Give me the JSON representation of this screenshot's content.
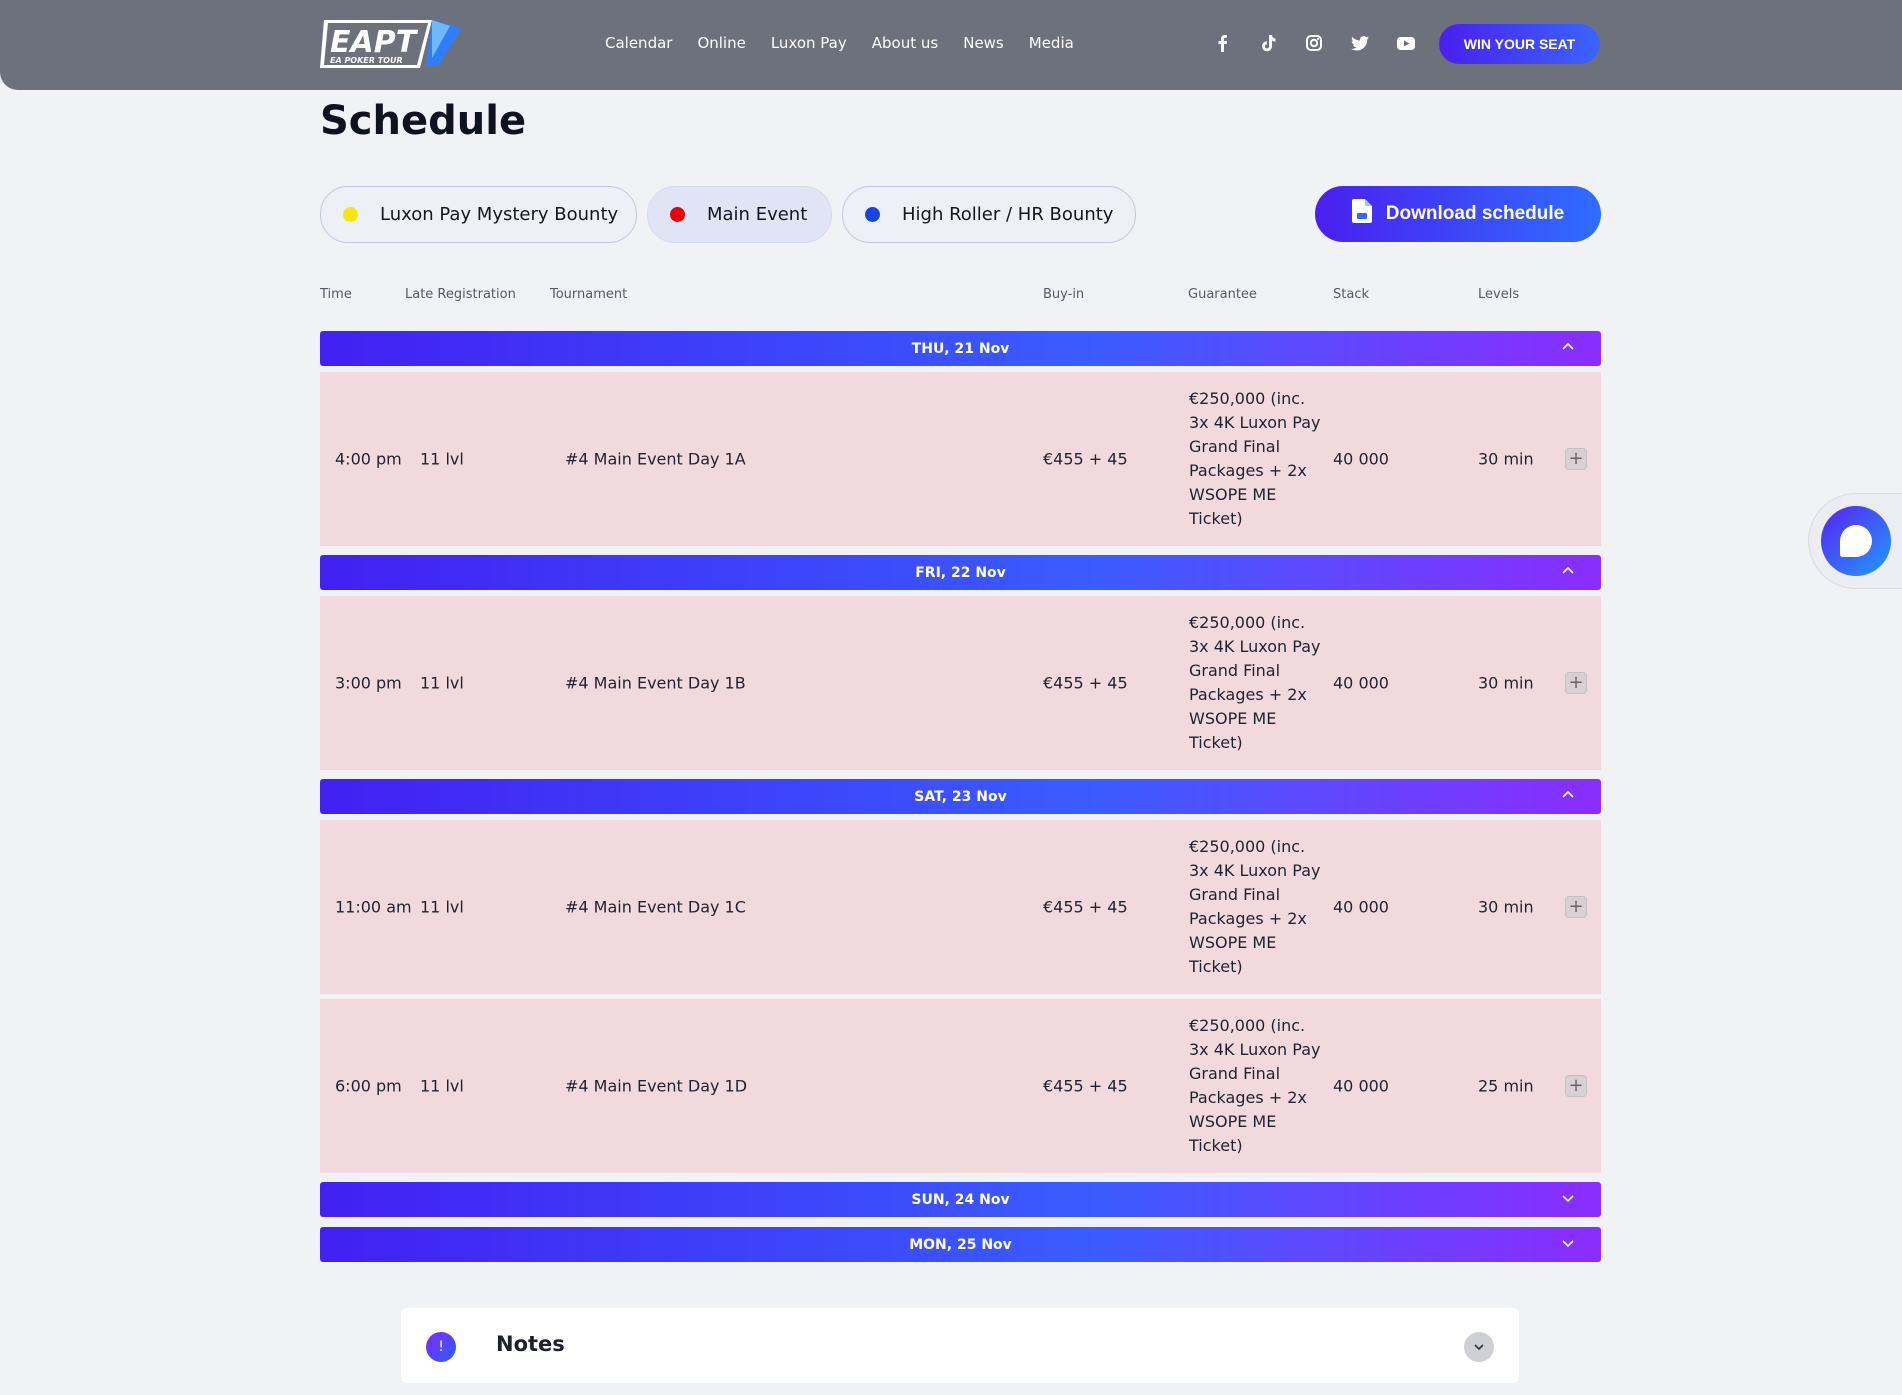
{
  "brand": {
    "logo_text": "EAPT",
    "logo_sub": "EA POKER TOUR"
  },
  "nav": [
    "Calendar",
    "Online",
    "Luxon Pay",
    "About us",
    "News",
    "Media"
  ],
  "social_icons": [
    "facebook-icon",
    "tiktok-icon",
    "instagram-icon",
    "twitter-icon",
    "youtube-icon"
  ],
  "cta": "WIN YOUR SEAT",
  "page_title": "Schedule",
  "filters": [
    {
      "label": "Luxon Pay Mystery Bounty",
      "color": "#f5e60f"
    },
    {
      "label": "Main Event",
      "color": "#e8000b"
    },
    {
      "label": "High Roller / HR Bounty",
      "color": "#1742e8"
    }
  ],
  "download_label": "Download schedule",
  "columns": [
    "Time",
    "Late Registration",
    "Tournament",
    "Buy-in",
    "Guarantee",
    "Stack",
    "Levels"
  ],
  "days": [
    {
      "label": "THU, 21 Nov",
      "expanded": true
    },
    {
      "label": "FRI, 22 Nov",
      "expanded": true
    },
    {
      "label": "SAT, 23 Nov",
      "expanded": true
    },
    {
      "label": "SUN, 24 Nov",
      "expanded": false
    },
    {
      "label": "MON, 25 Nov",
      "expanded": false
    }
  ],
  "events": [
    {
      "time": "4:00 pm",
      "late_reg": "11 lvl",
      "tournament": "#4 Main Event Day 1A",
      "buyin": "€455 + 45",
      "guarantee": "€250,000 (inc. 3x 4K Luxon Pay Grand Final Packages + 2x WSOPE ME Ticket)",
      "stack": "40 000",
      "levels": "30 min"
    },
    {
      "time": "3:00 pm",
      "late_reg": "11 lvl",
      "tournament": "#4 Main Event Day 1B",
      "buyin": "€455 + 45",
      "guarantee": "€250,000 (inc. 3x 4K Luxon Pay Grand Final Packages + 2x WSOPE ME Ticket)",
      "stack": "40 000",
      "levels": "30 min"
    },
    {
      "time": "11:00 am",
      "late_reg": "11 lvl",
      "tournament": "#4 Main Event Day 1C",
      "buyin": "€455 + 45",
      "guarantee": "€250,000 (inc. 3x 4K Luxon Pay Grand Final Packages + 2x WSOPE ME Ticket)",
      "stack": "40 000",
      "levels": "30 min"
    },
    {
      "time": "6:00 pm",
      "late_reg": "11 lvl",
      "tournament": "#4 Main Event Day 1D",
      "buyin": "€455 + 45",
      "guarantee": "€250,000 (inc. 3x 4K Luxon Pay Grand Final Packages + 2x WSOPE ME Ticket)",
      "stack": "40 000",
      "levels": "25 min"
    }
  ],
  "notes": {
    "label": "Notes",
    "badge": "!"
  }
}
